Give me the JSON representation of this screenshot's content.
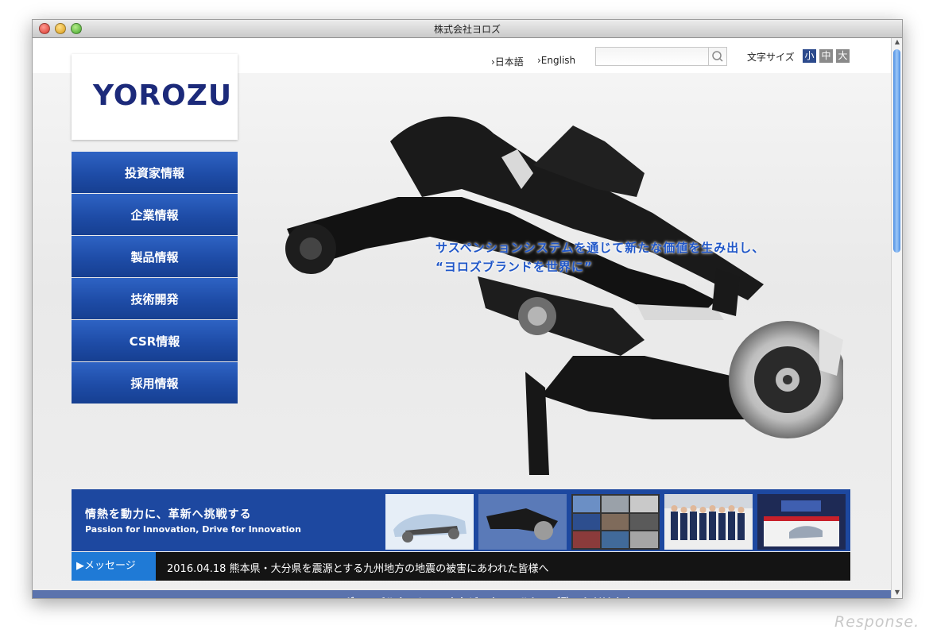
{
  "window": {
    "title": "株式会社ヨロズ"
  },
  "header": {
    "logo_text": "YOROZU",
    "lang_ja": "›日本語",
    "lang_en": "›English",
    "search_placeholder": "",
    "font_size_label": "文字サイズ",
    "font_sizes": [
      "小",
      "中",
      "大"
    ]
  },
  "nav": {
    "items": [
      "投資家情報",
      "企業情報",
      "製品情報",
      "技術開発",
      "CSR情報",
      "採用情報"
    ]
  },
  "hero": {
    "tagline_line1": "サスペンションシステムを通じて新たな価値を生み出し、",
    "tagline_line2": "“ヨロズブランドを世界に”"
  },
  "banner": {
    "title_jp": "情熱を動力に、革新へ挑戦する",
    "title_en": "Passion for Innovation,  Drive for Innovation"
  },
  "news": {
    "tab_label": "メッセージ",
    "text": "2016.04.18 熊本県・大分県を震源とする九州地方の地震の被害にあわれた皆様へ"
  },
  "footer": {
    "scroll_hint": "▼ ニュース・グローバルネットワークなどスクロールしてご覧いただけます。"
  },
  "watermark": "Response.",
  "colors": {
    "nav_blue": "#1e4ca7",
    "banner_blue": "#1d48a0",
    "tagline_blue": "#1f56c8",
    "news_tab": "#1f7ad6",
    "scroll_hint_bg": "#5b73ad"
  }
}
